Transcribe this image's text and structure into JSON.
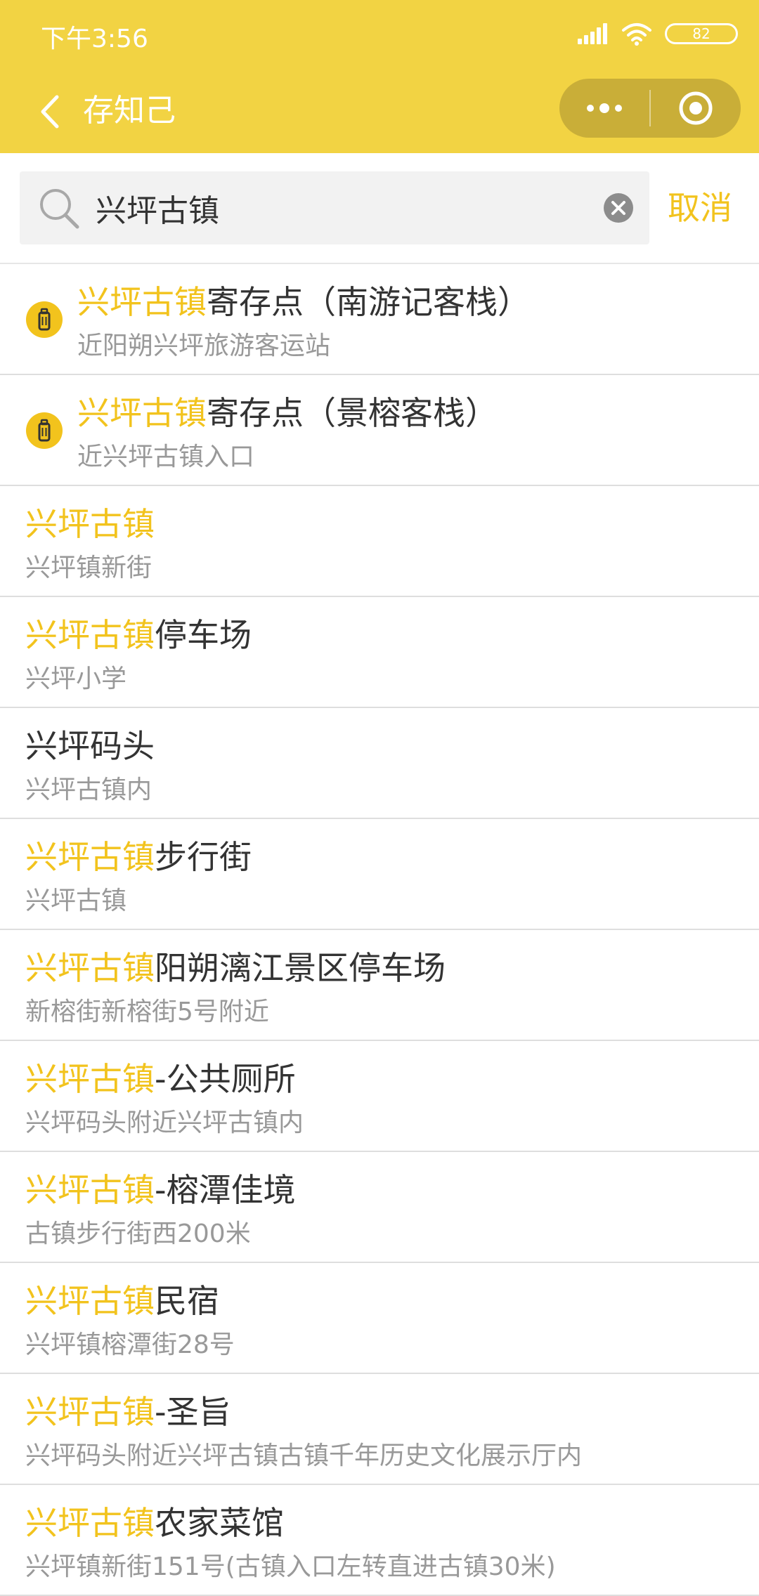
{
  "status_bar": {
    "time": "下午3:56",
    "battery": "82"
  },
  "nav": {
    "title": "存知己"
  },
  "search": {
    "value": "兴坪古镇",
    "cancel_label": "取消"
  },
  "colors": {
    "brand_yellow": "#F2D343",
    "highlight": "#F2C31D",
    "capsule": "#C9AE38"
  },
  "results": [
    {
      "hl": "兴坪古镇",
      "rest": "寄存点（南游记客栈）",
      "sub": "近阳朔兴坪旅游客运站",
      "icon": "locker-icon"
    },
    {
      "hl": "兴坪古镇",
      "rest": "寄存点（景榕客栈）",
      "sub": "近兴坪古镇入口",
      "icon": "locker-icon"
    },
    {
      "hl": "兴坪古镇",
      "rest": "",
      "sub": "兴坪镇新街"
    },
    {
      "hl": "兴坪古镇",
      "rest": "停车场",
      "sub": "兴坪小学"
    },
    {
      "hl": "",
      "rest": "兴坪码头",
      "sub": "兴坪古镇内"
    },
    {
      "hl": "兴坪古镇",
      "rest": "步行街",
      "sub": "兴坪古镇"
    },
    {
      "hl": "兴坪古镇",
      "rest": "阳朔漓江景区停车场",
      "sub": "新榕街新榕街5号附近"
    },
    {
      "hl": "兴坪古镇",
      "rest": "-公共厕所",
      "sub": "兴坪码头附近兴坪古镇内"
    },
    {
      "hl": "兴坪古镇",
      "rest": "-榕潭佳境",
      "sub": "古镇步行街西200米"
    },
    {
      "hl": "兴坪古镇",
      "rest": "民宿",
      "sub": "兴坪镇榕潭街28号"
    },
    {
      "hl": "兴坪古镇",
      "rest": "-圣旨",
      "sub": "兴坪码头附近兴坪古镇古镇千年历史文化展示厅内"
    },
    {
      "hl": "兴坪古镇",
      "rest": "农家菜馆",
      "sub": "兴坪镇新街151号(古镇入口左转直进古镇30米)"
    }
  ]
}
